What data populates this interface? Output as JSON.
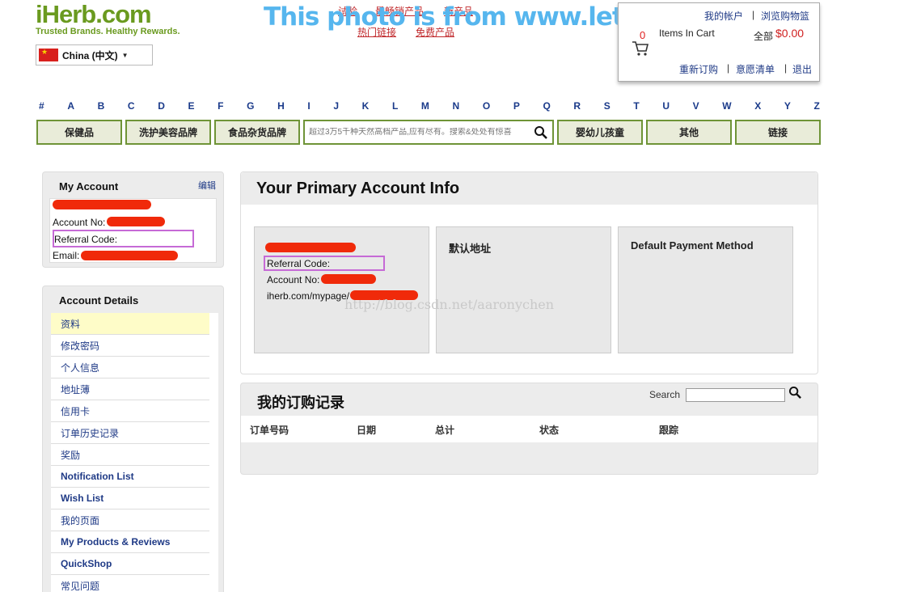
{
  "header": {
    "logo": "iHerb.com",
    "tagline": "Trusted Brands. Healthy Rewards.",
    "country": "China (中文)",
    "top_links": [
      "试验",
      "最畅销产品",
      "新产品",
      "热门链接",
      "免费产品"
    ],
    "watermark": "This photo is from www.letsebuy.com"
  },
  "cart": {
    "my_account": "我的帐户",
    "browse_cart": "浏览购物篮",
    "count": "0",
    "items_label": "Items In Cart",
    "total_label": "全部",
    "total_value": "$0.00",
    "reorder": "重新订购",
    "wishlist": "意愿清单",
    "logout": "退出"
  },
  "alphabet": [
    "#",
    "A",
    "B",
    "C",
    "D",
    "E",
    "F",
    "G",
    "H",
    "I",
    "J",
    "K",
    "L",
    "M",
    "N",
    "O",
    "P",
    "Q",
    "R",
    "S",
    "T",
    "U",
    "V",
    "W",
    "X",
    "Y",
    "Z"
  ],
  "nav": {
    "supplements": "保健品",
    "beauty": "洗护美容品牌",
    "grocery": "食品杂货品牌",
    "search_placeholder": "超过3万5千种天然高档产品,应有尽有。搜索&处处有惊喜",
    "baby": "婴幼儿孩童",
    "other": "其他",
    "links": "链接"
  },
  "my_account": {
    "title": "My Account",
    "edit": "编辑",
    "account_no_label": "Account No:",
    "referral_label": "Referral Code:",
    "email_label": "Email:"
  },
  "account_details": {
    "title": "Account Details",
    "items": [
      "资料",
      "修改密码",
      "个人信息",
      "地址薄",
      "信用卡",
      "订单历史记录",
      "奖励",
      "Notification List",
      "Wish List",
      "我的页面",
      "My Products & Reviews",
      "QuickShop",
      "常见问题"
    ]
  },
  "primary_info": {
    "title": "Your Primary Account Info",
    "card1": {
      "referral_label": "Referral Code:",
      "account_no_label": "Account No:",
      "mypage": "iherb.com/mypage/"
    },
    "card2_title": "默认地址",
    "card3_title": "Default Payment Method",
    "csdn_watermark": "http://blog.csdn.net/aaronychen"
  },
  "orders": {
    "title": "我的订购记录",
    "search_label": "Search",
    "columns": [
      "订单号码",
      "日期",
      "总计",
      "状态",
      "跟踪"
    ]
  },
  "colors": {
    "brand_green": "#6a9a1f",
    "link_blue": "#1f3a86",
    "link_red": "#c0282b",
    "redaction": "#f02a0a",
    "highlight_purple": "#c66ad6"
  }
}
